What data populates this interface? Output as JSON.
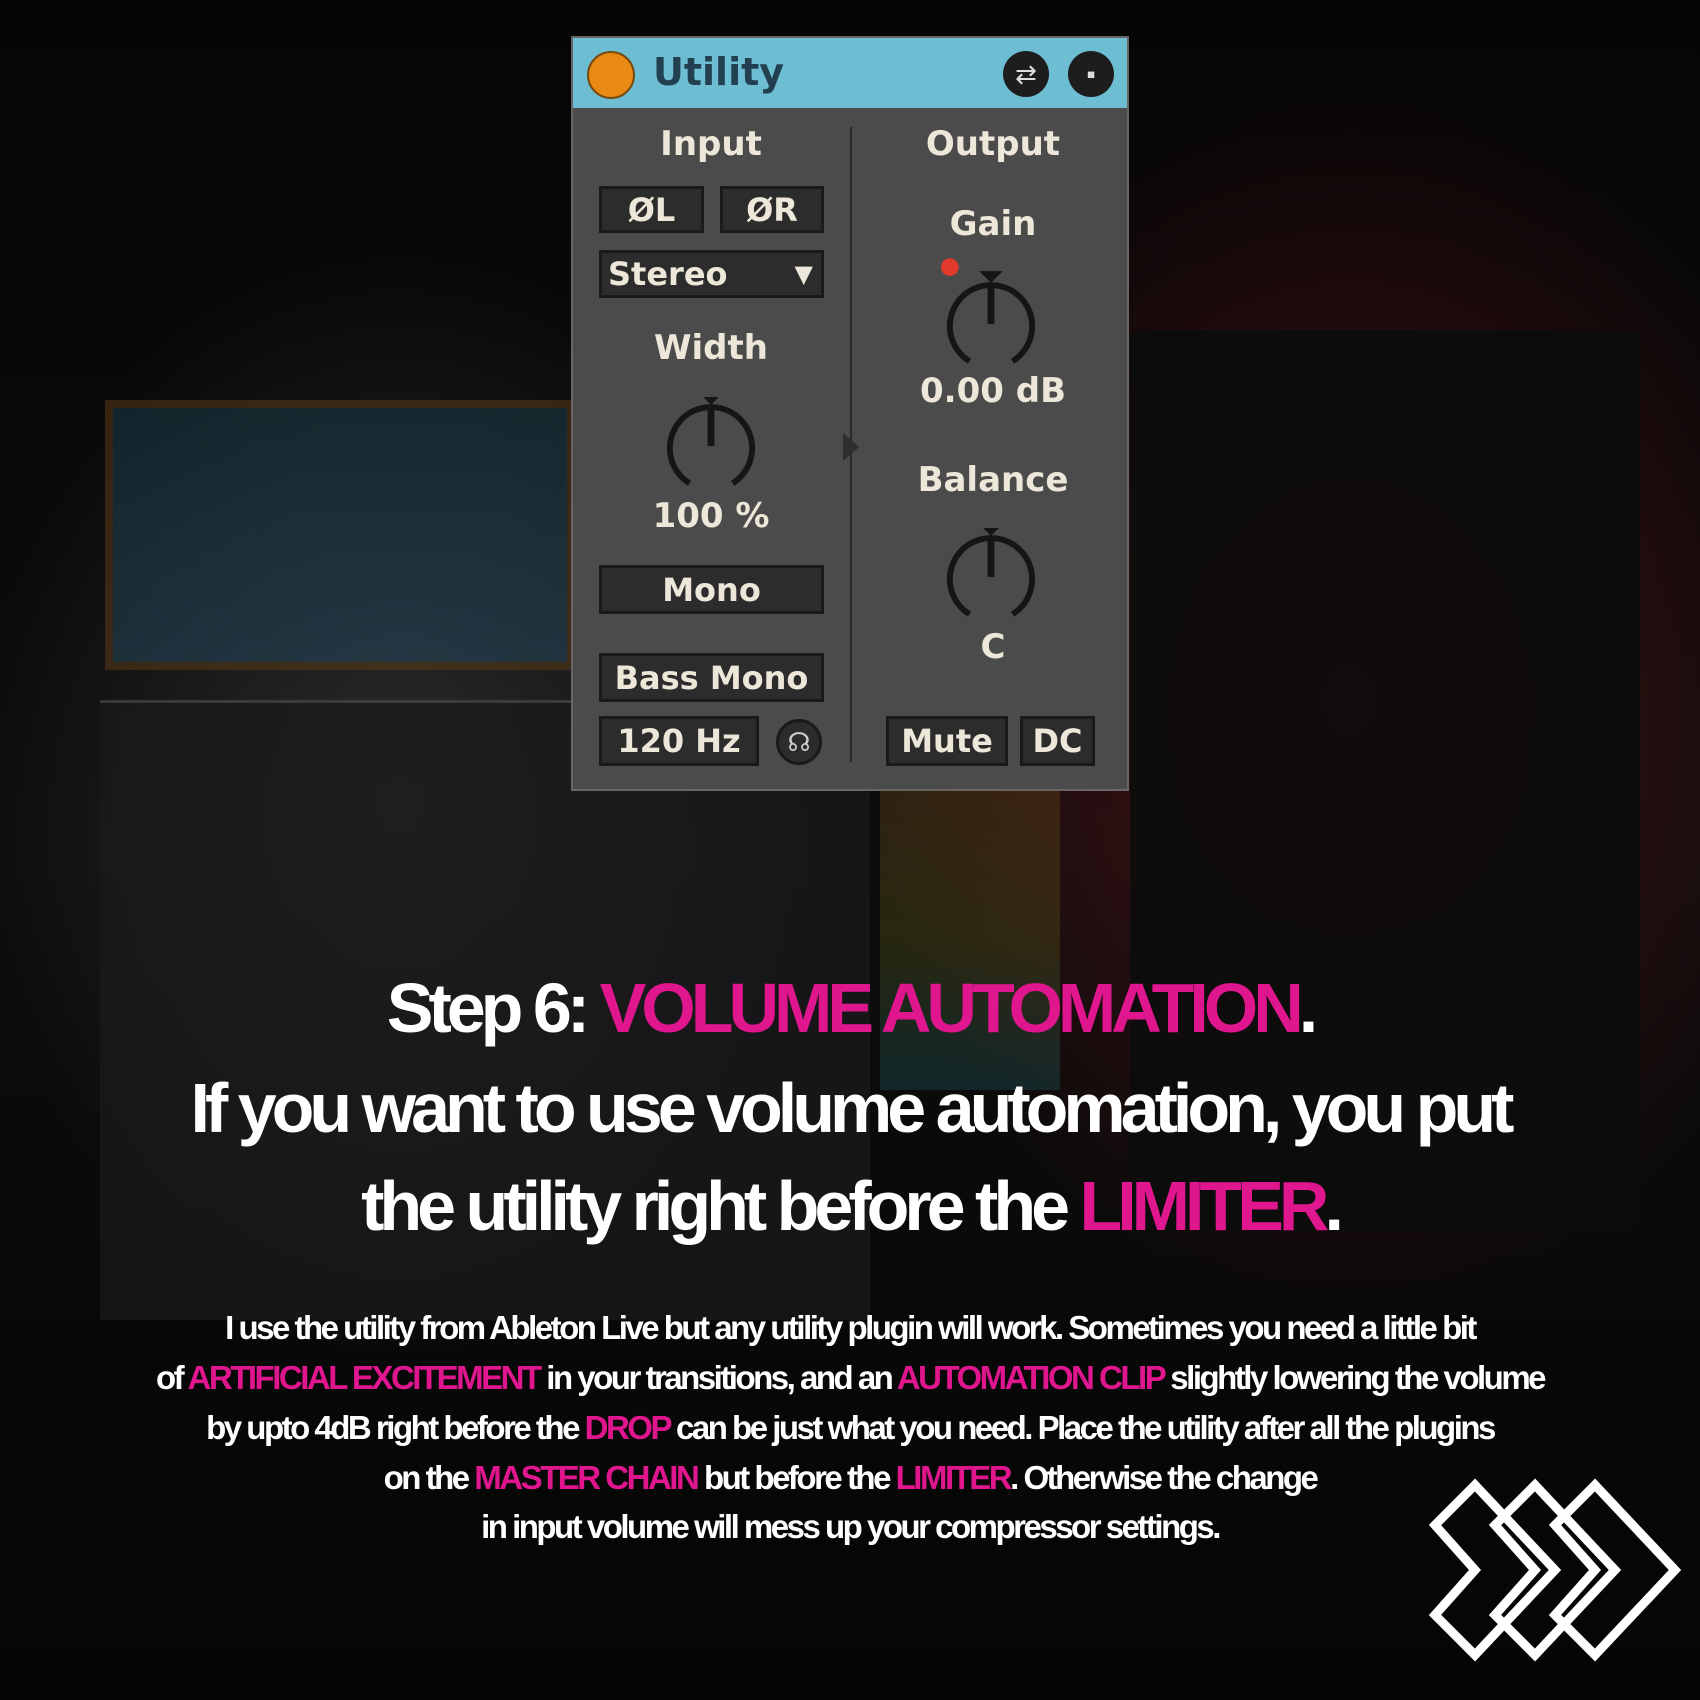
{
  "utility": {
    "title": "Utility",
    "header_icons": [
      "hot-swap-icon",
      "save-preset-icon"
    ],
    "input_label": "Input",
    "phase_left": "ØL",
    "phase_right": "ØR",
    "channel_mode": "Stereo",
    "width_label": "Width",
    "width_value": "100 %",
    "mono_label": "Mono",
    "bass_mono_label": "Bass Mono",
    "bass_mono_freq": "120 Hz",
    "output_label": "Output",
    "gain_label": "Gain",
    "gain_value": "0.00 dB",
    "balance_label": "Balance",
    "balance_value": "C",
    "mute_label": "Mute",
    "dc_label": "DC",
    "colors": {
      "header": "#6dbdd3",
      "power": "#e88a14",
      "panel": "#4b4b4b"
    }
  },
  "heading": {
    "line1_prefix": "Step 6: ",
    "line1_highlight": "VOLUME AUTOMATION",
    "line1_suffix": ".",
    "line2": "If you want to use volume automation, you put",
    "line3_prefix": "the utility right before the ",
    "line3_highlight": "LIMITER",
    "line3_suffix": "."
  },
  "body": {
    "l1": "I use the utility from Ableton Live but any utility plugin will work. Sometimes you need a little bit",
    "l2a": "of ",
    "l2b": "ARTIFICIAL EXCITEMENT",
    "l2c": " in your transitions, and an ",
    "l2d": "AUTOMATION CLIP",
    "l2e": " slightly lowering the volume",
    "l3a": "by upto 4dB right before the ",
    "l3b": "DROP",
    "l3c": " can be just what you need. Place the utility after all the plugins",
    "l4a": "on the ",
    "l4b": "MASTER CHAIN",
    "l4c": " but before the ",
    "l4d": "LIMITER",
    "l4e": ". Otherwise the change",
    "l5": "in input volume will mess up your compressor settings."
  },
  "accent_color": "#e0168f",
  "next_icon": "triple-chevron-right-icon"
}
